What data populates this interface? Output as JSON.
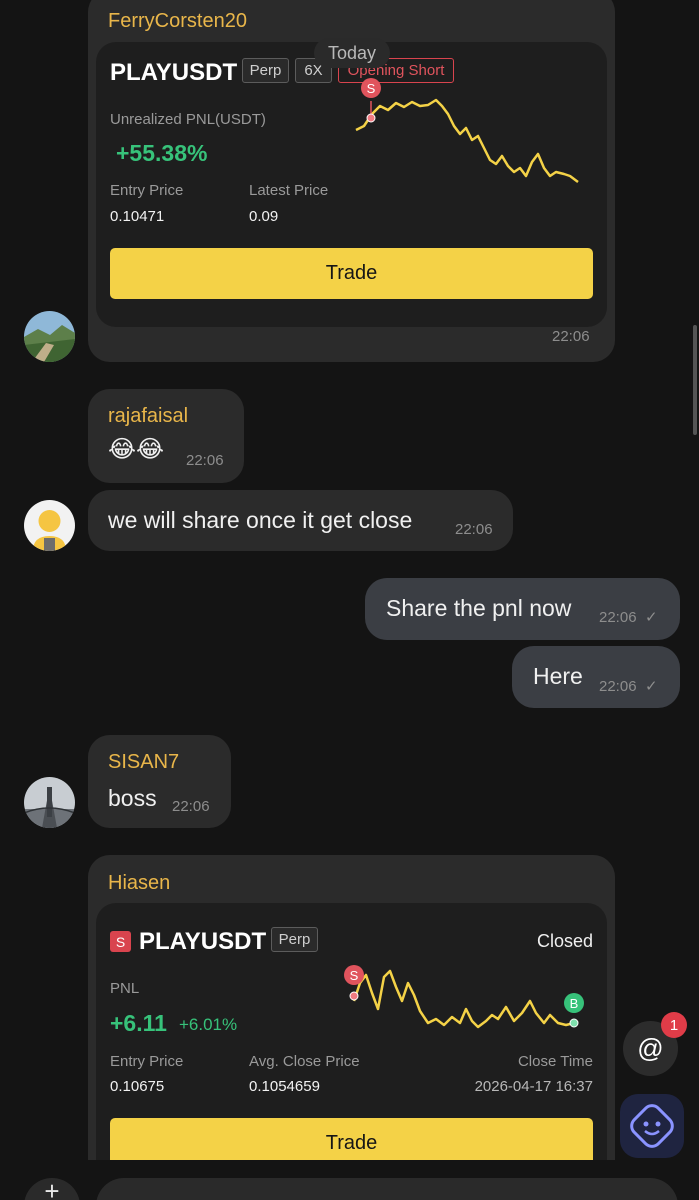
{
  "date_divider": "Today",
  "messages": {
    "m1": {
      "sender": "FerryCorsten20",
      "time": "22:06",
      "card": {
        "ticker": "PLAYUSDT",
        "tag_type": "Perp",
        "leverage": "6X",
        "position_status": "Opening Short",
        "pnl_label": "Unrealized PNL(USDT)",
        "pnl_value": "+55.38%",
        "entry_label": "Entry Price",
        "entry_value": "0.10471",
        "latest_label": "Latest Price",
        "latest_value": "0.09",
        "marker": "S",
        "button": "Trade"
      }
    },
    "m2": {
      "sender": "rajafaisal",
      "text": "😂😂",
      "time": "22:06"
    },
    "m3": {
      "text": "we will share once it get close",
      "time": "22:06"
    },
    "m4": {
      "text": "Share the pnl now",
      "time": "22:06",
      "status": "✓"
    },
    "m5": {
      "text": "Here",
      "time": "22:06",
      "status": "✓"
    },
    "m6": {
      "sender": "SISAN7",
      "text": "boss",
      "time": "22:06"
    },
    "m7": {
      "sender": "Hiasen",
      "card": {
        "side_icon": "S",
        "ticker": "PLAYUSDT",
        "tag_type": "Perp",
        "status": "Closed",
        "pnl_label": "PNL",
        "pnl_value": "+6.11",
        "pnl_pct": "+6.01%",
        "entry_label": "Entry Price",
        "entry_value": "0.10675",
        "close_label": "Avg. Close Price",
        "close_value": "0.1054659",
        "time_label": "Close Time",
        "time_value": "2026-04-17 16:37",
        "marker_start": "S",
        "marker_end": "B",
        "button": "Trade"
      }
    }
  },
  "mention_badge": "1",
  "icons": {
    "mention": "at-sign-icon",
    "assistant": "robot-face-icon",
    "add": "plus-icon"
  },
  "colors": {
    "accent_yellow": "#f4d247",
    "sender_gold": "#e9b64a",
    "profit_green": "#37c27a",
    "short_red": "#e0545d",
    "badge_red": "#e03c48"
  }
}
